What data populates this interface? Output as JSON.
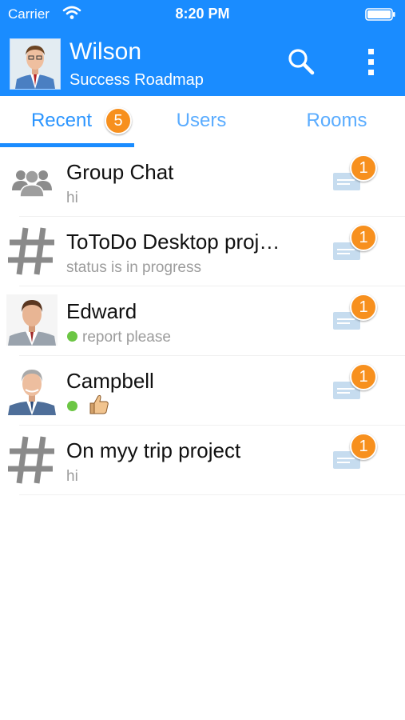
{
  "status_bar": {
    "carrier": "Carrier",
    "time": "8:20 PM"
  },
  "header": {
    "name": "Wilson",
    "subtitle": "Success Roadmap"
  },
  "tabs": [
    {
      "label": "Recent",
      "badge": "5",
      "active": true
    },
    {
      "label": "Users",
      "active": false
    },
    {
      "label": "Rooms",
      "active": false
    }
  ],
  "conversations": [
    {
      "title": "Group Chat",
      "preview": "hi",
      "unread": "1",
      "icon": "group-icon",
      "online": false
    },
    {
      "title": "ToToDo Desktop proj…",
      "preview": "status is in progress",
      "unread": "1",
      "icon": "hash-icon",
      "online": false
    },
    {
      "title": "Edward",
      "preview": "report please",
      "unread": "1",
      "icon": "avatar",
      "online": true
    },
    {
      "title": "Campbell",
      "preview": "",
      "unread": "1",
      "icon": "avatar",
      "online": true,
      "preview_icon": "thumbs-up-icon"
    },
    {
      "title": "On myy trip project",
      "preview": "hi",
      "unread": "1",
      "icon": "hash-icon",
      "online": false
    }
  ],
  "colors": {
    "header": "#1a8cff",
    "badge": "#f7901e",
    "online": "#6cc644",
    "muted_text": "#9c9c9c"
  }
}
